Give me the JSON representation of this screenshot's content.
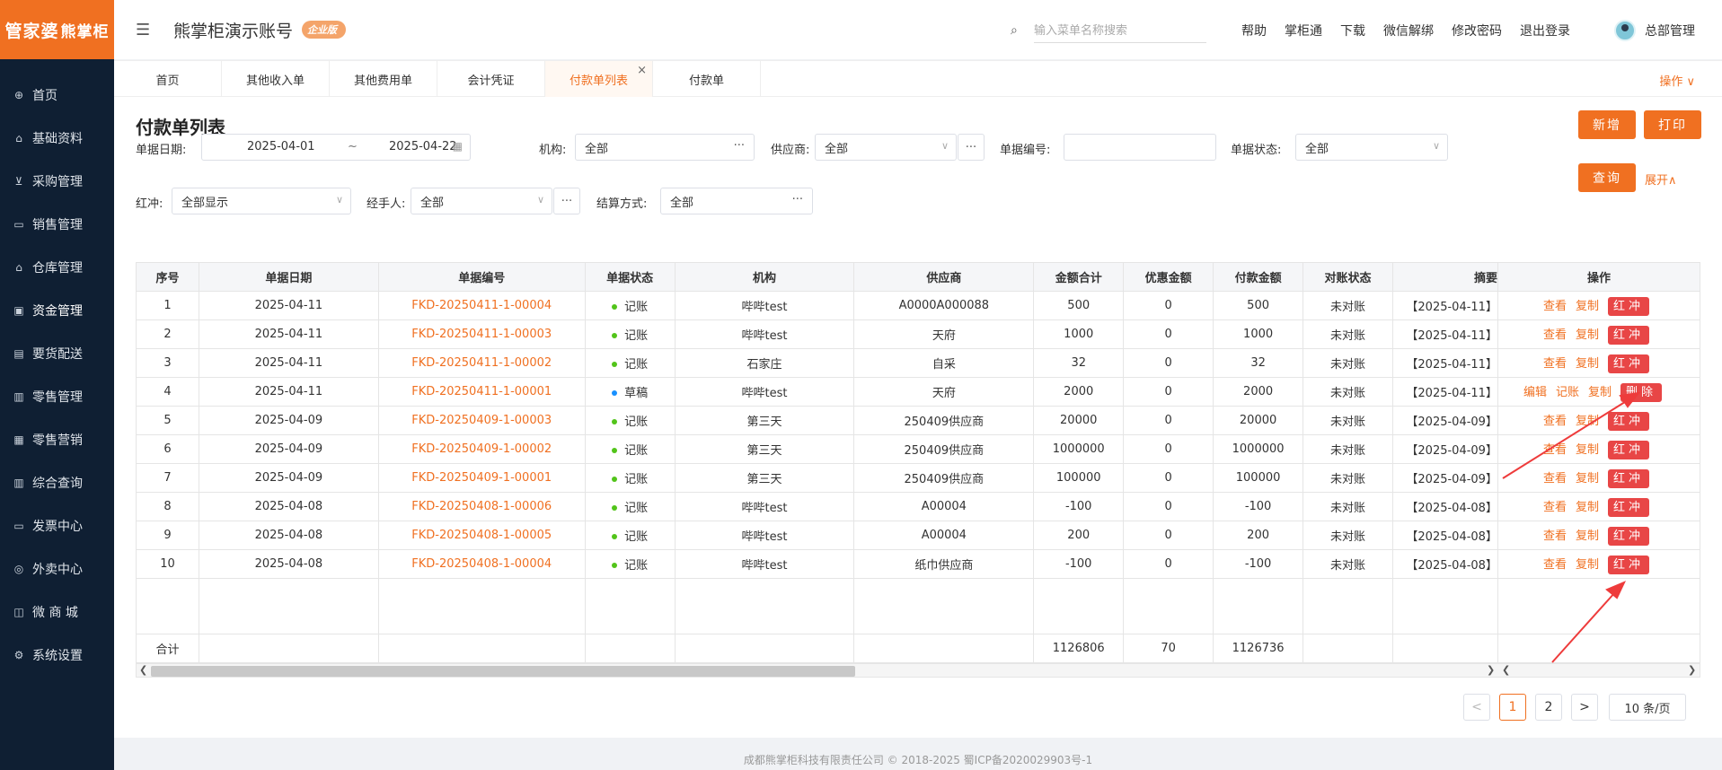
{
  "sidebar": {
    "logo_main": "管家婆",
    "logo_sub": "熊掌柜",
    "items": [
      {
        "label": "首页",
        "icon": "globe-icon"
      },
      {
        "label": "基础资料",
        "icon": "home-icon"
      },
      {
        "label": "采购管理",
        "icon": "cart-icon"
      },
      {
        "label": "销售管理",
        "icon": "sales-icon"
      },
      {
        "label": "仓库管理",
        "icon": "warehouse-icon"
      },
      {
        "label": "资金管理",
        "icon": "finance-icon"
      },
      {
        "label": "要货配送",
        "icon": "delivery-icon"
      },
      {
        "label": "零售管理",
        "icon": "retail-icon"
      },
      {
        "label": "零售营销",
        "icon": "gift-icon"
      },
      {
        "label": "综合查询",
        "icon": "chart-icon"
      },
      {
        "label": "发票中心",
        "icon": "invoice-icon"
      },
      {
        "label": "外卖中心",
        "icon": "takeaway-icon"
      },
      {
        "label": "微 商 城",
        "icon": "shop-icon"
      },
      {
        "label": "系统设置",
        "icon": "gear-icon"
      }
    ]
  },
  "header": {
    "account": "熊掌柜演示账号",
    "badge": "企业版",
    "search_placeholder": "输入菜单名称搜索",
    "links": [
      "帮助",
      "掌柜通",
      "下载",
      "微信解绑",
      "修改密码",
      "退出登录"
    ],
    "user": "总部管理"
  },
  "tabs": {
    "items": [
      "首页",
      "其他收入单",
      "其他费用单",
      "会计凭证",
      "付款单列表",
      "付款单"
    ],
    "active_index": 4,
    "close": "×",
    "ops": "操作 ∨"
  },
  "page": {
    "title": "付款单列表",
    "add": "新增",
    "print": "打印",
    "query": "查询",
    "expand": "展开∧"
  },
  "filters": {
    "date_label": "单据日期:",
    "date_from": "2025-04-01",
    "date_sep": "~",
    "date_to": "2025-04-22",
    "org_label": "机构:",
    "org_value": "全部",
    "supplier_label": "供应商:",
    "supplier_value": "全部",
    "docno_label": "单据编号:",
    "docno_value": "",
    "status_label": "单据状态:",
    "status_value": "全部",
    "redflush_label": "红冲:",
    "redflush_value": "全部显示",
    "handler_label": "经手人:",
    "handler_value": "全部",
    "settle_label": "结算方式:",
    "settle_value": "全部"
  },
  "table": {
    "headers": [
      "序号",
      "单据日期",
      "单据编号",
      "单据状态",
      "机构",
      "供应商",
      "金额合计",
      "优惠金额",
      "付款金额",
      "对账状态",
      "摘要",
      "操作"
    ],
    "rows": [
      {
        "no": "1",
        "date": "2025-04-11",
        "code": "FKD-20250411-1-00004",
        "status": "记账",
        "status_color": "green",
        "org": "哔哔test",
        "supplier": "A0000A000088",
        "total": "500",
        "discount": "0",
        "paid": "500",
        "recon": "未对账",
        "memo": "【2025-04-11】",
        "ops": [
          "查看",
          "复制"
        ],
        "red": "红冲"
      },
      {
        "no": "2",
        "date": "2025-04-11",
        "code": "FKD-20250411-1-00003",
        "status": "记账",
        "status_color": "green",
        "org": "哔哔test",
        "supplier": "天府",
        "total": "1000",
        "discount": "0",
        "paid": "1000",
        "recon": "未对账",
        "memo": "【2025-04-11】",
        "ops": [
          "查看",
          "复制"
        ],
        "red": "红冲"
      },
      {
        "no": "3",
        "date": "2025-04-11",
        "code": "FKD-20250411-1-00002",
        "status": "记账",
        "status_color": "green",
        "org": "石家庄",
        "supplier": "自采",
        "total": "32",
        "discount": "0",
        "paid": "32",
        "recon": "未对账",
        "memo": "【2025-04-11】",
        "ops": [
          "查看",
          "复制"
        ],
        "red": "红冲"
      },
      {
        "no": "4",
        "date": "2025-04-11",
        "code": "FKD-20250411-1-00001",
        "status": "草稿",
        "status_color": "blue",
        "org": "哔哔test",
        "supplier": "天府",
        "total": "2000",
        "discount": "0",
        "paid": "2000",
        "recon": "未对账",
        "memo": "【2025-04-11】",
        "ops": [
          "编辑",
          "记账",
          "复制"
        ],
        "red": "删除"
      },
      {
        "no": "5",
        "date": "2025-04-09",
        "code": "FKD-20250409-1-00003",
        "status": "记账",
        "status_color": "green",
        "org": "第三天",
        "supplier": "250409供应商",
        "total": "20000",
        "discount": "0",
        "paid": "20000",
        "recon": "未对账",
        "memo": "【2025-04-09】",
        "ops": [
          "查看",
          "复制"
        ],
        "red": "红冲"
      },
      {
        "no": "6",
        "date": "2025-04-09",
        "code": "FKD-20250409-1-00002",
        "status": "记账",
        "status_color": "green",
        "org": "第三天",
        "supplier": "250409供应商",
        "total": "1000000",
        "discount": "0",
        "paid": "1000000",
        "recon": "未对账",
        "memo": "【2025-04-09】",
        "ops": [
          "查看",
          "复制"
        ],
        "red": "红冲"
      },
      {
        "no": "7",
        "date": "2025-04-09",
        "code": "FKD-20250409-1-00001",
        "status": "记账",
        "status_color": "green",
        "org": "第三天",
        "supplier": "250409供应商",
        "total": "100000",
        "discount": "0",
        "paid": "100000",
        "recon": "未对账",
        "memo": "【2025-04-09】",
        "ops": [
          "查看",
          "复制"
        ],
        "red": "红冲"
      },
      {
        "no": "8",
        "date": "2025-04-08",
        "code": "FKD-20250408-1-00006",
        "status": "记账",
        "status_color": "green",
        "org": "哔哔test",
        "supplier": "A00004",
        "total": "-100",
        "discount": "0",
        "paid": "-100",
        "recon": "未对账",
        "memo": "【2025-04-08】",
        "ops": [
          "查看",
          "复制"
        ],
        "red": "红冲"
      },
      {
        "no": "9",
        "date": "2025-04-08",
        "code": "FKD-20250408-1-00005",
        "status": "记账",
        "status_color": "green",
        "org": "哔哔test",
        "supplier": "A00004",
        "total": "200",
        "discount": "0",
        "paid": "200",
        "recon": "未对账",
        "memo": "【2025-04-08】",
        "ops": [
          "查看",
          "复制"
        ],
        "red": "红冲"
      },
      {
        "no": "10",
        "date": "2025-04-08",
        "code": "FKD-20250408-1-00004",
        "status": "记账",
        "status_color": "green",
        "org": "哔哔test",
        "supplier": "纸巾供应商",
        "total": "-100",
        "discount": "0",
        "paid": "-100",
        "recon": "未对账",
        "memo": "【2025-04-08】",
        "ops": [
          "查看",
          "复制"
        ],
        "red": "红冲"
      }
    ],
    "summary": {
      "label": "合计",
      "total": "1126806",
      "discount": "70",
      "paid": "1126736"
    }
  },
  "pagination": {
    "pages": [
      "1",
      "2"
    ],
    "current": "1",
    "prev": "<",
    "next": ">",
    "page_size": "10 条/页"
  },
  "footer": "成都熊掌柜科技有限责任公司 © 2018-2025 蜀ICP备2020029903号-1",
  "colors": {
    "accent": "#f07021",
    "sidebar": "#0f1f33",
    "red_button": "#e84646",
    "annotation_arrow": "#ee3b3b"
  }
}
